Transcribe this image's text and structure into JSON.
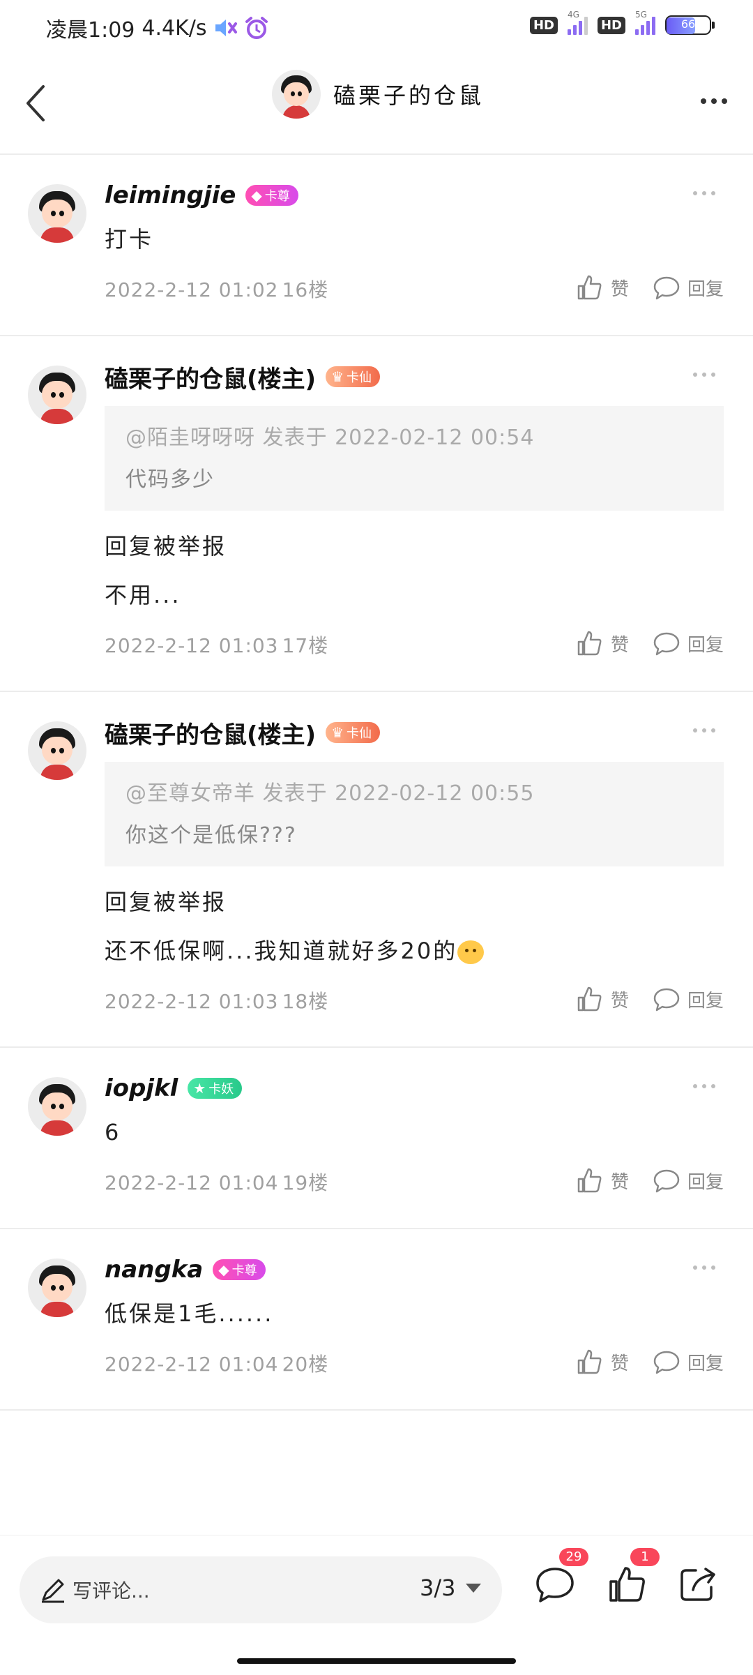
{
  "status_bar": {
    "time": "凌晨1:09",
    "speed": "4.4K/s",
    "hd1": "HD",
    "hd2": "HD",
    "net1": "4G",
    "net2": "5G",
    "battery": "66",
    "battery_level": 0.66
  },
  "header": {
    "title": "磕栗子的仓鼠"
  },
  "comments": [
    {
      "name": "leimingjie",
      "badge": "卡尊",
      "badge_color": "#ff4fb3",
      "quote": null,
      "lines": [
        "打卡"
      ],
      "time": "2022-2-12 01:02",
      "floor": "16楼",
      "like": "赞",
      "reply": "回复"
    },
    {
      "name": "磕栗子的仓鼠(楼主)",
      "badge": "卡仙",
      "badge_color": "#f26b4b",
      "quote": {
        "head": "@陌圭呀呀呀 发表于 2022-02-12 00:54",
        "body": "代码多少"
      },
      "lines": [
        "回复被举报",
        "不用..."
      ],
      "time": "2022-2-12 01:03",
      "floor": "17楼",
      "like": "赞",
      "reply": "回复"
    },
    {
      "name": "磕栗子的仓鼠(楼主)",
      "badge": "卡仙",
      "badge_color": "#f26b4b",
      "quote": {
        "head": "@至尊女帝羊 发表于 2022-02-12 00:55",
        "body": "你这个是低保???"
      },
      "lines": [
        "回复被举报",
        "还不低保啊...我知道就好多20的"
      ],
      "time": "2022-2-12 01:03",
      "floor": "18楼",
      "like": "赞",
      "reply": "回复"
    },
    {
      "name": "iopjkl",
      "badge": "卡妖",
      "badge_color": "#28c98a",
      "quote": null,
      "lines": [
        "6"
      ],
      "time": "2022-2-12 01:04",
      "floor": "19楼",
      "like": "赞",
      "reply": "回复"
    },
    {
      "name": "nangka",
      "badge": "卡尊",
      "badge_color": "#ff4fb3",
      "quote": null,
      "lines": [
        "低保是1毛......"
      ],
      "time": "2022-2-12 01:04",
      "floor": "20楼",
      "like": "赞",
      "reply": "回复"
    }
  ],
  "bottom_bar": {
    "placeholder": "写评论...",
    "page": "3/3",
    "comment_count": "29",
    "like_count": "1"
  }
}
